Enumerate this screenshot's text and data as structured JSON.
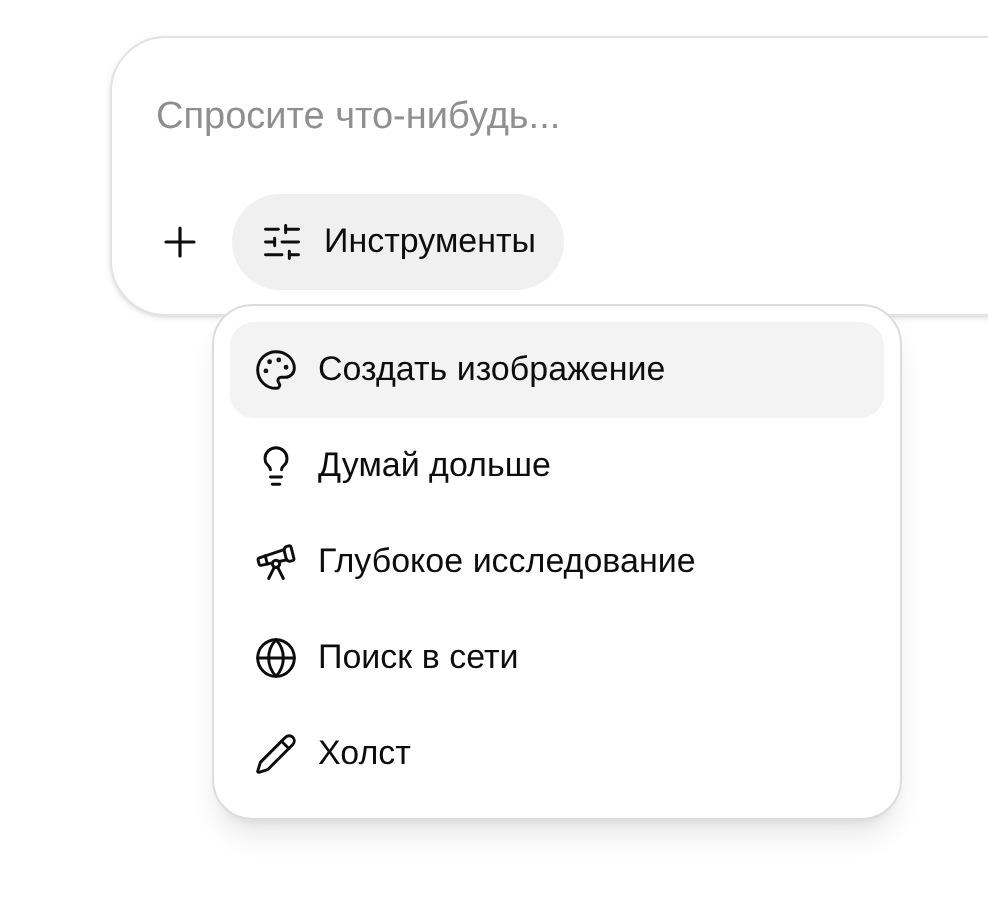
{
  "composer": {
    "placeholder": "Спросите что-нибудь...",
    "tools_button": {
      "label": "Инструменты"
    }
  },
  "menu": {
    "items": [
      {
        "label": "Создать изображение",
        "selected": true
      },
      {
        "label": "Думай дольше",
        "selected": false
      },
      {
        "label": "Глубокое исследование",
        "selected": false
      },
      {
        "label": "Поиск в сети",
        "selected": false
      },
      {
        "label": "Холст",
        "selected": false
      }
    ]
  }
}
